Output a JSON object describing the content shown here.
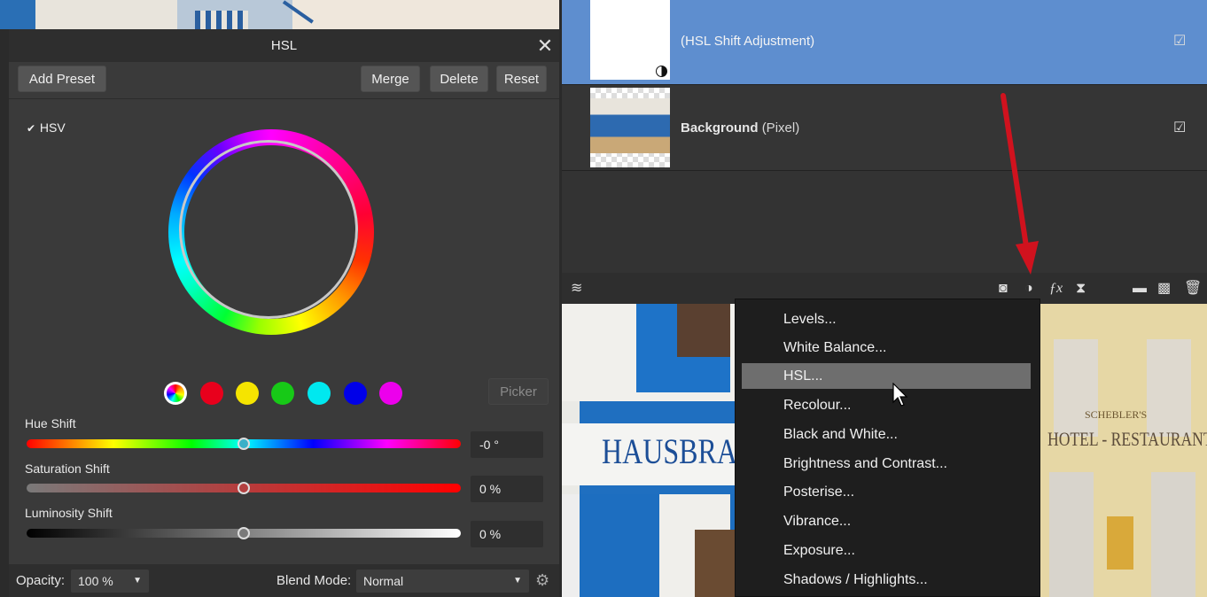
{
  "hsl_panel": {
    "title": "HSL",
    "buttons": {
      "add_preset": "Add Preset",
      "merge": "Merge",
      "delete": "Delete",
      "reset": "Reset",
      "picker": "Picker"
    },
    "hsv_checkbox": {
      "label": "HSV",
      "checked": true
    },
    "swatches": [
      {
        "name": "master",
        "color": "multicolor"
      },
      {
        "name": "red",
        "color": "#e8001c"
      },
      {
        "name": "yellow",
        "color": "#f5e400"
      },
      {
        "name": "green",
        "color": "#17c917"
      },
      {
        "name": "cyan",
        "color": "#00e8ef"
      },
      {
        "name": "blue",
        "color": "#0000e8"
      },
      {
        "name": "magenta",
        "color": "#ec00ec"
      }
    ],
    "sliders": {
      "hue": {
        "label": "Hue Shift",
        "value_text": "-0 °",
        "position_fraction": 0.5
      },
      "saturation": {
        "label": "Saturation Shift",
        "value_text": "0 %",
        "position_fraction": 0.5
      },
      "luminosity": {
        "label": "Luminosity Shift",
        "value_text": "0 %",
        "position_fraction": 0.5
      }
    },
    "bottom": {
      "opacity_label": "Opacity:",
      "opacity_value": "100 %",
      "blend_label": "Blend Mode:",
      "blend_value": "Normal"
    }
  },
  "layers": [
    {
      "name": "",
      "type": "(HSL Shift Adjustment)",
      "selected": true,
      "visible": true
    },
    {
      "name": "Background",
      "type": "(Pixel)",
      "selected": false,
      "visible": true
    }
  ],
  "photo_text": {
    "sign": "HAUSBRAUE",
    "hotel": "HOTEL - RESTAURANT",
    "hotel_small": "SCHEBLER'S"
  },
  "adjustment_menu": {
    "items": [
      {
        "label": "Levels..."
      },
      {
        "label": "White Balance..."
      },
      {
        "label": "HSL...",
        "highlighted": true
      },
      {
        "label": "Recolour..."
      },
      {
        "label": "Black and White..."
      },
      {
        "label": "Brightness and Contrast..."
      },
      {
        "label": "Posterise..."
      },
      {
        "label": "Vibrance..."
      },
      {
        "label": "Exposure..."
      },
      {
        "label": "Shadows / Highlights..."
      }
    ]
  },
  "colors": {
    "accent_selected": "#5e8ecf",
    "annotation_arrow": "#d0121e",
    "menu_highlight": "#6e6e6e"
  }
}
